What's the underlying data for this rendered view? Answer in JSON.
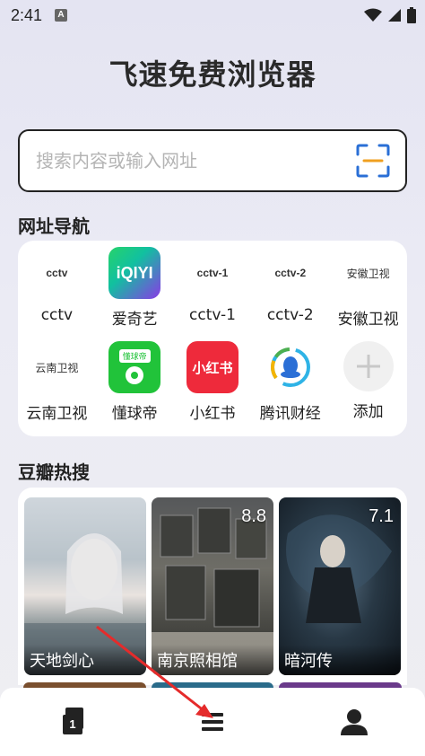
{
  "status_bar": {
    "time": "2:41",
    "notification_badge": "A"
  },
  "app_title": "飞速免费浏览器",
  "search": {
    "placeholder": "搜索内容或输入网址",
    "scan_icon": "scan-icon"
  },
  "nav_section": {
    "title": "网址导航",
    "items": [
      {
        "icon_text": "cctv",
        "label": "cctv"
      },
      {
        "icon_text": "iQIYI",
        "label": "爱奇艺"
      },
      {
        "icon_text": "cctv-1",
        "label": "cctv-1"
      },
      {
        "icon_text": "cctv-2",
        "label": "cctv-2"
      },
      {
        "icon_text": "安徽卫视",
        "label": "安徽卫视"
      },
      {
        "icon_text": "云南卫视",
        "label": "云南卫视"
      },
      {
        "icon_text": "懂球帝",
        "label": "懂球帝"
      },
      {
        "icon_text": "小红书",
        "label": "小红书"
      },
      {
        "icon_text": "",
        "label": "腾讯财经"
      },
      {
        "icon_text": "+",
        "label": "添加"
      }
    ]
  },
  "hot_section": {
    "title": "豆瓣热搜",
    "movies": [
      {
        "title": "天地剑心",
        "score": ""
      },
      {
        "title": "南京照相馆",
        "score": "8.8"
      },
      {
        "title": "暗河传",
        "score": "7.1"
      }
    ]
  },
  "bottom_bar": {
    "tabs_count": "1"
  },
  "colors": {
    "accent_scan": "#f0a020",
    "scan_blue": "#2a6fd6",
    "annotation_arrow": "#e52b2b"
  }
}
